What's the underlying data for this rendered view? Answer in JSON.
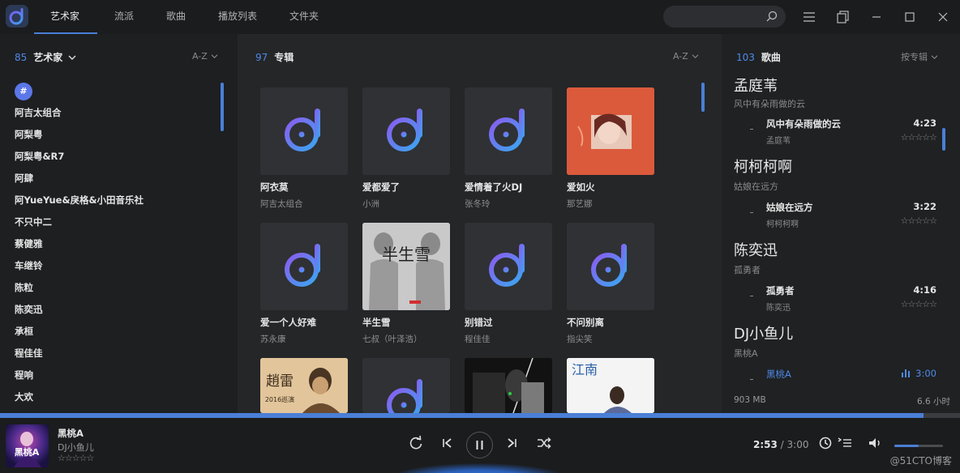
{
  "nav": {
    "tabs": [
      "艺术家",
      "流派",
      "歌曲",
      "播放列表",
      "文件夹"
    ],
    "active": 0
  },
  "artists": {
    "count": "85",
    "title": "艺术家",
    "sort": "A-Z",
    "index_letter": "#",
    "items": [
      "阿吉太组合",
      "阿梨粤",
      "阿梨粤&R7",
      "阿肆",
      "阿YueYue&戾格&小田音乐社",
      "不只中二",
      "蔡健雅",
      "车继铃",
      "陈粒",
      "陈奕迅",
      "承桓",
      "程佳佳",
      "程响",
      "大欢"
    ]
  },
  "albums": {
    "count": "97",
    "title": "专辑",
    "sort": "A-Z",
    "items": [
      {
        "title": "阿衣莫",
        "artist": "阿吉太组合"
      },
      {
        "title": "爱都爱了",
        "artist": "小洲"
      },
      {
        "title": "爱情着了火DJ",
        "artist": "张冬玲"
      },
      {
        "title": "爱如火",
        "artist": "那艺娜"
      },
      {
        "title": "爱一个人好难",
        "artist": "苏永康"
      },
      {
        "title": "半生雪",
        "artist": "七叔（叶泽浩）"
      },
      {
        "title": "别错过",
        "artist": "程佳佳"
      },
      {
        "title": "不问别离",
        "artist": "指尖笑"
      }
    ],
    "art_text": {
      "half": "半生雪",
      "zhaolei": "趙雷",
      "year": "2016巡演",
      "jiangnan": "江南"
    }
  },
  "songs": {
    "count": "103",
    "title": "歌曲",
    "sort": "按专辑",
    "groups": [
      {
        "artist": "孟庭苇",
        "album": "风中有朵雨做的云",
        "song": "风中有朵雨做的云",
        "song_artist": "孟庭苇",
        "duration": "4:23"
      },
      {
        "artist": "柯柯柯啊",
        "album": "姑娘在远方",
        "song": "姑娘在远方",
        "song_artist": "柯柯柯啊",
        "duration": "3:22"
      },
      {
        "artist": "陈奕迅",
        "album": "孤勇者",
        "song": "孤勇者",
        "song_artist": "陈奕迅",
        "duration": "4:16"
      },
      {
        "artist": "DJ小鱼儿",
        "album": "黑桃A",
        "song": "黑桃A",
        "song_artist": "",
        "duration": "3:00"
      }
    ],
    "stars": "☆☆☆☆☆",
    "footer_size": "903 MB",
    "footer_time": "6.6 小时"
  },
  "player": {
    "title": "黑桃A",
    "artist": "DJ小鱼儿",
    "stars": "☆☆☆☆☆",
    "current": "2:53",
    "sep": " / ",
    "total": "3:00",
    "progress": 0.962,
    "volume": 0.5,
    "cover_text": "黑桃A"
  },
  "watermark": "@51CTO博客",
  "colors": {
    "accent": "#4a7fd6",
    "count": "#4f89e6",
    "logo_from": "#7b5cf0",
    "logo_to": "#3fa0f0"
  },
  "icons": [
    "search-icon",
    "menu-icon",
    "copy-icon",
    "minimize-icon",
    "maximize-icon",
    "close-icon",
    "chevron-down-icon",
    "repeat-icon",
    "previous-icon",
    "pause-icon",
    "next-icon",
    "shuffle-icon",
    "timer-icon",
    "queue-icon",
    "volume-icon",
    "equalizer-icon"
  ]
}
